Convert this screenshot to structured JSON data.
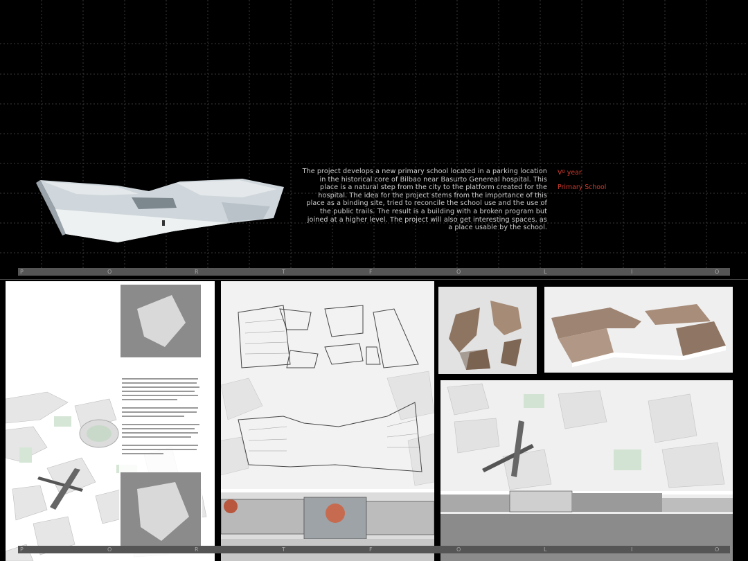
{
  "description": "The  project  develops a new primary school located in a parking location in the historical core of Bilbao near Basurto Genereal hospital. This place is a natural step from the city to the platform created for the hospital. The idea for the project stems from the importance of this place as a binding site, tried to reconcile the school use and the use of the public trails. The result is a building with a broken program but joined at a higher level. The project will also get interesting spaces, as a place usable by the school.",
  "year_label": "Vº year",
  "project_type": "Primary School",
  "portfolio_letters": [
    "P",
    "O",
    "R",
    "T",
    "F",
    "O",
    "L",
    "I",
    "O"
  ],
  "colors": {
    "accent": "#d23a2e",
    "background": "#000000",
    "strip": "#555555"
  }
}
